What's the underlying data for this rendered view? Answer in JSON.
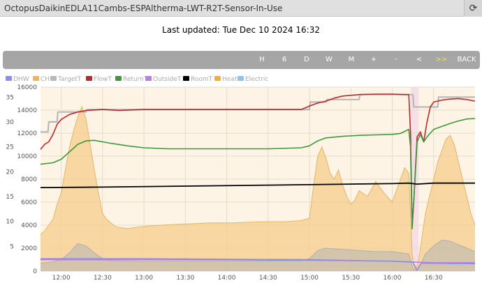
{
  "header": {
    "title": "OctopusDaikinEDLA11Cambs-ESPAltherma-LWT-R2T-Sensor-In-Use",
    "refresh_icon": "refresh-icon"
  },
  "status": {
    "last_updated": "Last updated: Tue Dec 10 2024 16:32"
  },
  "toolbar": {
    "buttons": [
      {
        "label": "H",
        "highlight": false
      },
      {
        "label": "6",
        "highlight": false
      },
      {
        "label": "D",
        "highlight": false
      },
      {
        "label": "W",
        "highlight": false
      },
      {
        "label": "M",
        "highlight": false
      },
      {
        "label": "+",
        "highlight": false
      },
      {
        "label": "-",
        "highlight": false
      },
      {
        "label": "<",
        "highlight": false
      },
      {
        "label": ">>",
        "highlight": true
      },
      {
        "label": "BACK",
        "highlight": false
      }
    ]
  },
  "chart_data": {
    "type": "line",
    "legend": [
      {
        "name": "DHW",
        "color": "#8b8df0"
      },
      {
        "name": "CH",
        "color": "#f4b54a"
      },
      {
        "name": "TargetT",
        "color": "#b8b8b8"
      },
      {
        "name": "FlowT",
        "color": "#c0262c"
      },
      {
        "name": "ReturnT",
        "color": "#3a9a3a"
      },
      {
        "name": "OutsideT",
        "color": "#b77fe0"
      },
      {
        "name": "RoomT",
        "color": "#000000"
      },
      {
        "name": "Heat",
        "color": "#f0b030"
      },
      {
        "name": "Electric",
        "color": "#8ec4ee"
      }
    ],
    "legend_placement": "top-left",
    "left_axis": {
      "min": 0,
      "max": 37,
      "ticks": [
        5,
        10,
        15,
        20,
        25,
        30,
        35
      ]
    },
    "right_axis": {
      "min": 0,
      "max": 16000,
      "ticks": [
        0,
        2000,
        4000,
        6000,
        8000,
        10000,
        12000,
        14000,
        16000
      ]
    },
    "x_range": [
      11.75,
      17.0
    ],
    "x_ticks": [
      "12:00",
      "12:30",
      "13:00",
      "13:30",
      "14:00",
      "14:30",
      "15:00",
      "15:30",
      "16:00",
      "16:30"
    ],
    "x_tick_values": [
      12.0,
      12.5,
      13.0,
      13.5,
      14.0,
      14.5,
      15.0,
      15.5,
      16.0,
      16.5
    ],
    "grid": true,
    "series": [
      {
        "name": "Heat",
        "axis": "right",
        "style": "area",
        "color": "#f0b030",
        "x": [
          11.75,
          11.8,
          11.85,
          11.9,
          11.95,
          12.0,
          12.05,
          12.1,
          12.15,
          12.2,
          12.25,
          12.3,
          12.35,
          12.4,
          12.45,
          12.5,
          12.55,
          12.6,
          12.65,
          12.7,
          12.8,
          12.9,
          13.0,
          13.2,
          13.5,
          13.8,
          14.1,
          14.4,
          14.7,
          14.9,
          15.0,
          15.05,
          15.1,
          15.15,
          15.2,
          15.25,
          15.3,
          15.35,
          15.4,
          15.45,
          15.5,
          15.55,
          15.6,
          15.7,
          15.8,
          15.9,
          16.0,
          16.05,
          16.1,
          16.15,
          16.2,
          16.22,
          16.24,
          16.26,
          16.28,
          16.3,
          16.33,
          16.36,
          16.4,
          16.45,
          16.5,
          16.55,
          16.6,
          16.65,
          16.7,
          16.75,
          16.8,
          16.85,
          16.9,
          16.95,
          17.0
        ],
        "y": [
          3200,
          3500,
          4000,
          4500,
          5800,
          6800,
          8800,
          10800,
          12200,
          13400,
          14300,
          13200,
          11000,
          8800,
          6800,
          5000,
          4500,
          4200,
          3900,
          3800,
          3700,
          3800,
          3900,
          4000,
          4100,
          4200,
          4200,
          4300,
          4300,
          4400,
          4600,
          7500,
          10000,
          10800,
          9800,
          8500,
          8000,
          8800,
          7500,
          6500,
          5800,
          6200,
          7000,
          6500,
          7800,
          6800,
          6000,
          7000,
          8000,
          9000,
          8500,
          5000,
          1500,
          500,
          200,
          400,
          1500,
          3000,
          5000,
          6500,
          8000,
          9500,
          10500,
          11500,
          11800,
          11000,
          9500,
          8000,
          6500,
          5000,
          4000
        ]
      },
      {
        "name": "Electric",
        "axis": "right",
        "style": "area",
        "color": "#cccccc",
        "x": [
          11.75,
          11.9,
          12.0,
          12.1,
          12.2,
          12.3,
          12.4,
          12.5,
          12.6,
          13.0,
          14.0,
          14.9,
          15.0,
          15.1,
          15.2,
          15.4,
          15.6,
          15.8,
          16.0,
          16.1,
          16.2,
          16.25,
          16.3,
          16.35,
          16.4,
          16.5,
          16.6,
          16.7,
          16.8,
          16.9,
          17.0
        ],
        "y": [
          700,
          800,
          1000,
          1600,
          2400,
          2200,
          1600,
          1100,
          900,
          850,
          850,
          900,
          1100,
          1800,
          2000,
          1900,
          1800,
          1700,
          1700,
          1600,
          1500,
          200,
          100,
          700,
          1500,
          2200,
          2700,
          2600,
          2300,
          2000,
          1700
        ]
      },
      {
        "name": "TargetT",
        "axis": "left",
        "style": "line",
        "color": "#b8b8b8",
        "x": [
          11.75,
          11.84,
          11.85,
          11.95,
          11.96,
          12.3,
          12.31,
          15.0,
          15.01,
          15.2,
          15.21,
          15.6,
          15.61,
          16.25,
          16.26,
          16.55,
          16.56,
          17.0
        ],
        "y": [
          28,
          28,
          30,
          30,
          32,
          32,
          32.5,
          32.5,
          34,
          34,
          34.5,
          34.5,
          35.5,
          35.5,
          33,
          33,
          35,
          35
        ]
      },
      {
        "name": "FlowT",
        "axis": "left",
        "style": "line",
        "color": "#c0262c",
        "x": [
          11.75,
          11.8,
          11.85,
          11.9,
          11.95,
          12.0,
          12.1,
          12.2,
          12.3,
          12.5,
          12.7,
          13.0,
          13.5,
          14.0,
          14.5,
          14.9,
          15.0,
          15.1,
          15.2,
          15.3,
          15.4,
          15.6,
          15.8,
          16.0,
          16.15,
          16.2,
          16.22,
          16.24,
          16.26,
          16.3,
          16.34,
          16.38,
          16.42,
          16.46,
          16.5,
          16.6,
          16.7,
          16.8,
          16.9,
          17.0
        ],
        "y": [
          24.5,
          25.5,
          26,
          27.5,
          29.5,
          30.5,
          31.5,
          32,
          32.3,
          32.5,
          32.3,
          32.5,
          32.5,
          32.5,
          32.5,
          32.5,
          33.2,
          33.8,
          34.2,
          34.8,
          35.2,
          35.5,
          35.6,
          35.6,
          35.5,
          35.5,
          28,
          9,
          14,
          27,
          28,
          26,
          30,
          33,
          34,
          34.4,
          34.6,
          34.7,
          34.5,
          34.2
        ]
      },
      {
        "name": "ReturnT",
        "axis": "left",
        "style": "line",
        "color": "#3a9a3a",
        "x": [
          11.75,
          11.9,
          12.0,
          12.1,
          12.2,
          12.3,
          12.4,
          12.6,
          12.8,
          13.0,
          13.3,
          13.6,
          14.0,
          14.5,
          14.9,
          15.0,
          15.1,
          15.2,
          15.4,
          15.6,
          15.8,
          16.0,
          16.1,
          16.2,
          16.22,
          16.24,
          16.26,
          16.3,
          16.34,
          16.38,
          16.42,
          16.5,
          16.6,
          16.7,
          16.8,
          16.9,
          17.0
        ],
        "y": [
          21.5,
          21.8,
          22.5,
          24,
          25.5,
          26.2,
          26.3,
          25.7,
          25.2,
          24.8,
          24.6,
          24.6,
          24.6,
          24.6,
          24.8,
          25.2,
          26.2,
          26.8,
          27.1,
          27.3,
          27.4,
          27.5,
          27.7,
          28.5,
          25,
          8.5,
          14,
          26,
          27.5,
          26,
          27,
          28.5,
          29.1,
          29.7,
          30.2,
          30.6,
          30.7
        ]
      },
      {
        "name": "RoomT",
        "axis": "left",
        "style": "line",
        "color": "#000000",
        "x": [
          11.75,
          12.5,
          13.5,
          14.5,
          15.5,
          16.0,
          16.2,
          16.3,
          16.5,
          17.0
        ],
        "y": [
          16.8,
          16.9,
          17.1,
          17.3,
          17.5,
          17.6,
          17.7,
          17.5,
          17.7,
          17.7
        ]
      },
      {
        "name": "OutsideT",
        "axis": "left",
        "style": "line",
        "color": "#b77fe0",
        "x": [
          11.75,
          13.0,
          15.0,
          16.0,
          16.3,
          16.5,
          17.0
        ],
        "y": [
          2.3,
          2.3,
          2.2,
          2.0,
          1.8,
          1.7,
          1.7
        ]
      },
      {
        "name": "DHW",
        "axis": "left",
        "style": "line",
        "color": "#8b8df0",
        "x": [
          11.75,
          13.0,
          14.0,
          15.0,
          16.0,
          16.25,
          16.3,
          16.35,
          16.4,
          17.0
        ],
        "y": [
          2.5,
          2.5,
          2.4,
          2.3,
          2.0,
          1.8,
          0.2,
          1.6,
          1.6,
          1.5
        ]
      }
    ]
  }
}
